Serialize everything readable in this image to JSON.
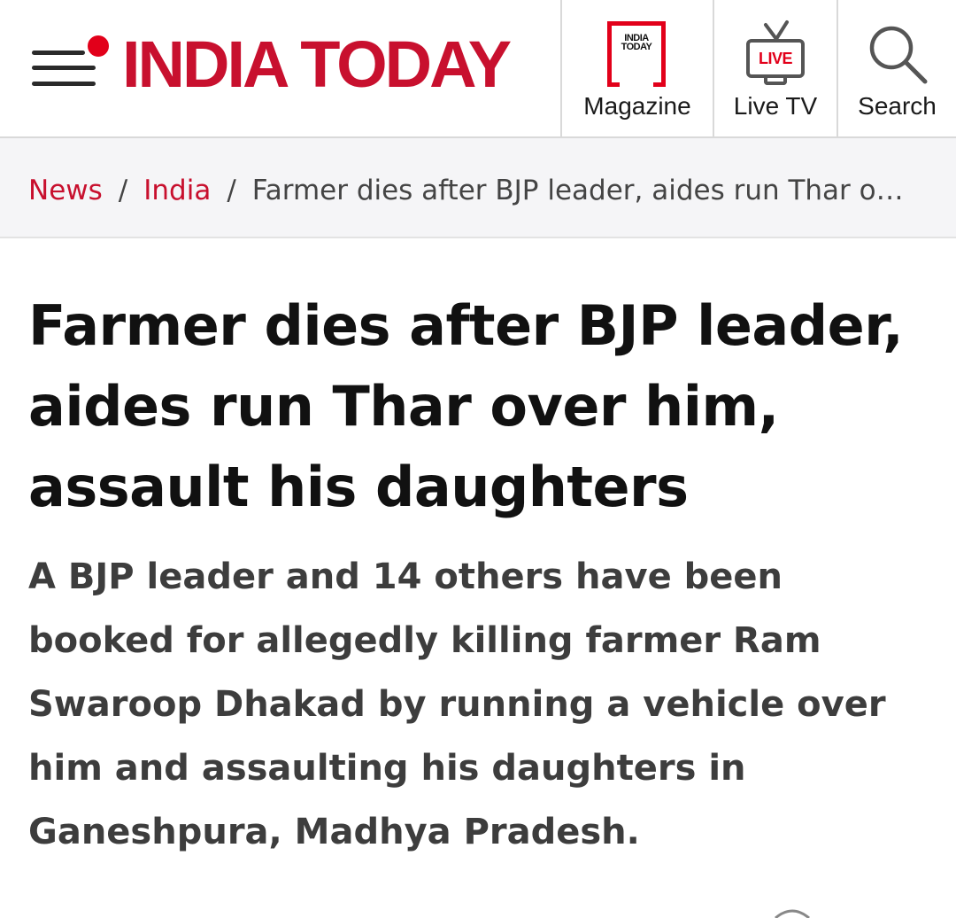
{
  "header": {
    "logo_text": "INDIA TODAY",
    "brand_color": "#c8102e",
    "menu_icon": "hamburger-menu-icon",
    "nav": {
      "magazine": {
        "label": "Magazine",
        "icon": "magazine-icon",
        "icon_text": "INDIA TODAY"
      },
      "live_tv": {
        "label": "Live TV",
        "icon": "live-tv-icon",
        "icon_text": "LIVE"
      },
      "search": {
        "label": "Search",
        "icon": "search-icon"
      }
    }
  },
  "breadcrumb": {
    "items": [
      "News",
      "India"
    ],
    "separator": "/",
    "current": "Farmer dies after BJP leader, aides run Thar over him, assault his daughters"
  },
  "article": {
    "headline": "Farmer dies after BJP leader, aides run Thar over him, assault his daughters",
    "summary": "A BJP leader and 14 others have been booked for allegedly killing farmer Ram Swaroop Dhakad by running a vehicle over him and assaulting his daughters in Ganeshpura, Madhya Pradesh."
  }
}
